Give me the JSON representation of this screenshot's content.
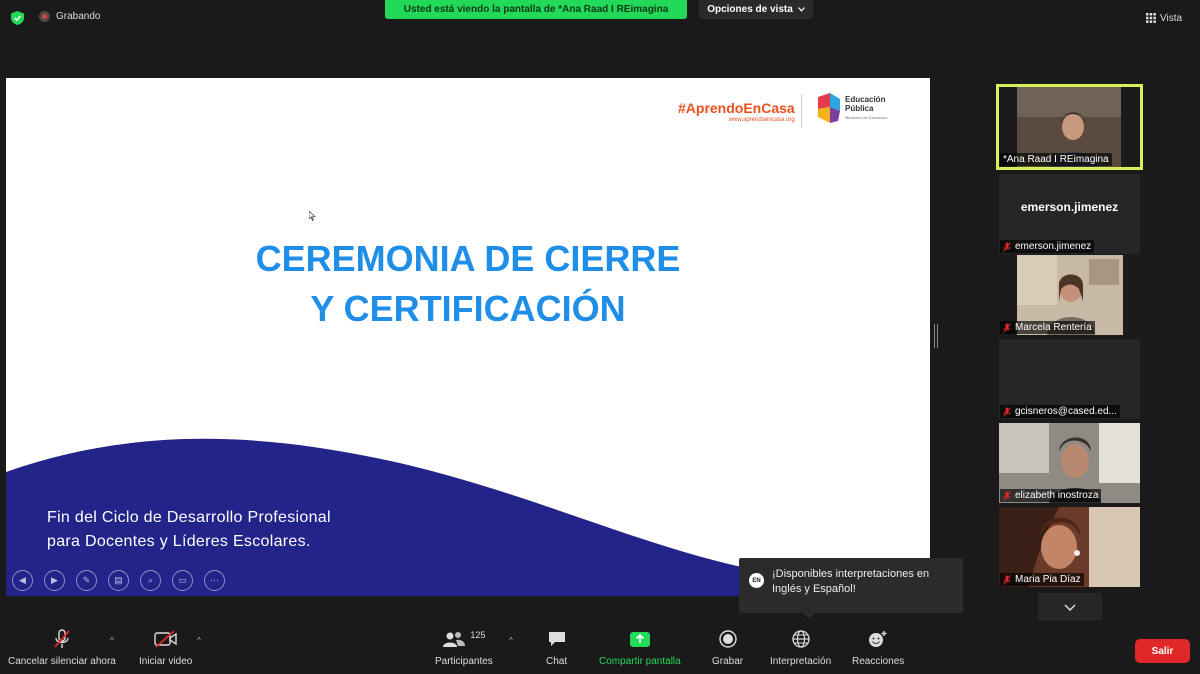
{
  "topbar": {
    "recording_label": "Grabando",
    "share_banner": "Usted está viendo la pantalla de *Ana Raad I REimagina",
    "view_options_label": "Opciones de vista",
    "view_label": "Vista"
  },
  "slide": {
    "logo_aprendo": "#AprendoEnCasa",
    "logo_aprendo_url": "www.aprendoencasa.org",
    "logo_edu_line1": "Educación",
    "logo_edu_line2": "Pública",
    "logo_edu_small": "Ministerio de Educación",
    "title_line1": "CEREMONIA DE CIERRE",
    "title_line2": "Y CERTIFICACIÓN",
    "subtitle_line1": "Fin del Ciclo de Desarrollo Profesional",
    "subtitle_line2": "para Docentes y Líderes Escolares.",
    "colors": {
      "title": "#1e8ee8",
      "wave": "#23248a"
    }
  },
  "participants": [
    {
      "name": "*Ana Raad I REimagina",
      "active": true,
      "video": true
    },
    {
      "name": "emerson.jimenez",
      "display": "emerson.jimenez",
      "video": false,
      "muted": true
    },
    {
      "name": "Marcela Rentería",
      "video": true,
      "muted": true
    },
    {
      "name": "gcisneros@cased.ed...",
      "video": false,
      "muted": true
    },
    {
      "name": "elizabeth inostroza",
      "video": true,
      "muted": true
    },
    {
      "name": "Maria Pia Díaz",
      "video": true,
      "muted": true
    }
  ],
  "tooltip": {
    "badge": "EN",
    "text_line1": "¡Disponibles interpretaciones en",
    "text_line2": "Inglés y Español!"
  },
  "toolbar": {
    "unmute_label": "Cancelar silenciar ahora",
    "video_label": "Iniciar video",
    "participants_label": "Participantes",
    "participants_count": "125",
    "chat_label": "Chat",
    "share_label": "Compartir pantalla",
    "record_label": "Grabar",
    "interpretation_label": "Interpretación",
    "reactions_label": "Reacciones",
    "leave_label": "Salir"
  }
}
